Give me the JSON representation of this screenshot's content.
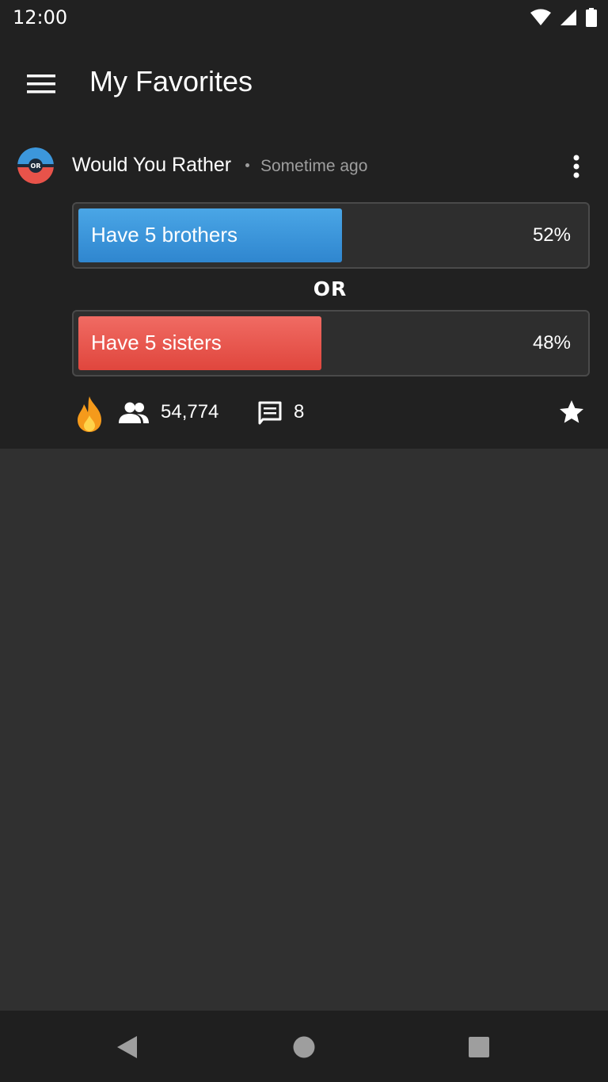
{
  "status_bar": {
    "time": "12:00"
  },
  "app_bar": {
    "title": "My Favorites"
  },
  "card": {
    "source": "Would You Rather",
    "time": "Sometime ago",
    "option_a": {
      "label": "Have 5 brothers",
      "percent": "52%",
      "color": "#3c97dc"
    },
    "or_label": "OR",
    "option_b": {
      "label": "Have 5 sisters",
      "percent": "48%",
      "color": "#e8534a"
    },
    "voters": "54,774",
    "comments": "8"
  },
  "icons": {
    "menu": "menu-icon",
    "more": "more-vert-icon",
    "fire": "fire-icon",
    "users": "users-icon",
    "comment": "comment-icon",
    "star": "star-icon",
    "back": "back-icon",
    "home": "home-icon",
    "recent": "recent-apps-icon"
  }
}
